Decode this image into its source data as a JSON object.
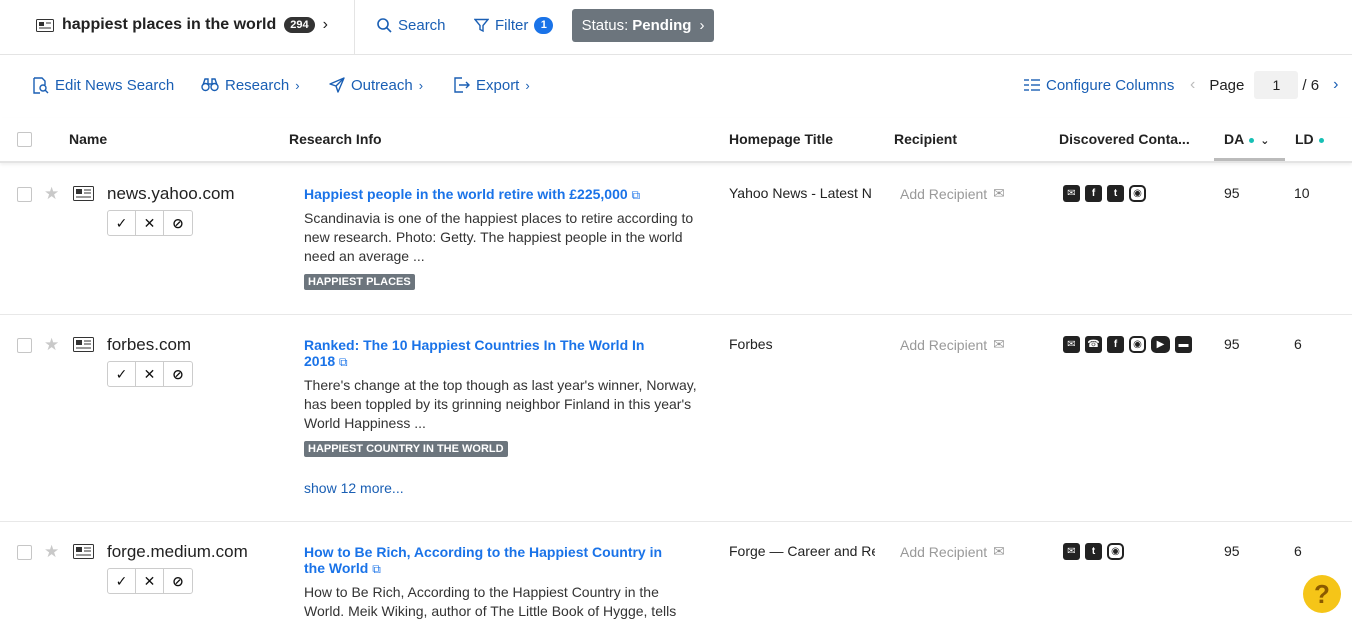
{
  "topbar": {
    "search_title": "happiest places in the world",
    "result_count": "294",
    "search_label": "Search",
    "filter_label": "Filter",
    "filter_count": "1",
    "status_prefix": "Status:",
    "status_value": "Pending"
  },
  "toolbar": {
    "edit_label": "Edit News Search",
    "research_label": "Research",
    "outreach_label": "Outreach",
    "export_label": "Export",
    "configure_label": "Configure Columns",
    "page_label": "Page",
    "page_current": "1",
    "page_total": "/ 6"
  },
  "columns": {
    "name": "Name",
    "research": "Research Info",
    "homepage": "Homepage Title",
    "recipient": "Recipient",
    "discovered": "Discovered Conta...",
    "da": "DA",
    "ld": "LD"
  },
  "rows": [
    {
      "domain": "news.yahoo.com",
      "title": "Happiest people in the world retire with £225,000",
      "snippet": "Scandinavia is one of the happiest places to retire according to new research. Photo: Getty. The happiest people in the world need an average ...",
      "tag": "HAPPIEST PLACES",
      "homepage_title": "Yahoo News - Latest N",
      "recipient": "Add Recipient",
      "contacts": [
        "email-icon",
        "facebook-icon",
        "twitter-icon",
        "instagram-icon"
      ],
      "da": "95",
      "ld": "10"
    },
    {
      "domain": "forbes.com",
      "title": "Ranked: The 10 Happiest Countries In The World In 2018",
      "snippet": "There's change at the top though as last year's winner, Norway, has been toppled by its grinning neighbor Finland in this year's World Happiness ...",
      "tag": "HAPPIEST COUNTRY IN THE WORLD",
      "more": "show 12 more...",
      "homepage_title": "Forbes",
      "recipient": "Add Recipient",
      "contacts": [
        "email-icon",
        "phone-icon",
        "facebook-icon",
        "instagram-icon",
        "youtube-icon",
        "form-icon"
      ],
      "da": "95",
      "ld": "6"
    },
    {
      "domain": "forge.medium.com",
      "title": "How to Be Rich, According to the Happiest Country in the World",
      "snippet": "How to Be Rich, According to the Happiest Country in the World. Meik Wiking, author of The Little Book of Hygge, tells",
      "homepage_title": "Forge — Career and Re",
      "recipient": "Add Recipient",
      "contacts": [
        "email-icon",
        "twitter-icon",
        "instagram-icon"
      ],
      "da": "95",
      "ld": "6"
    }
  ],
  "colors": {
    "link": "#1a73e8",
    "status_bg": "#6c757d",
    "tag_bg": "#6c757d",
    "accent_dot": "#17c0b5",
    "help_bg": "#f5c518"
  }
}
